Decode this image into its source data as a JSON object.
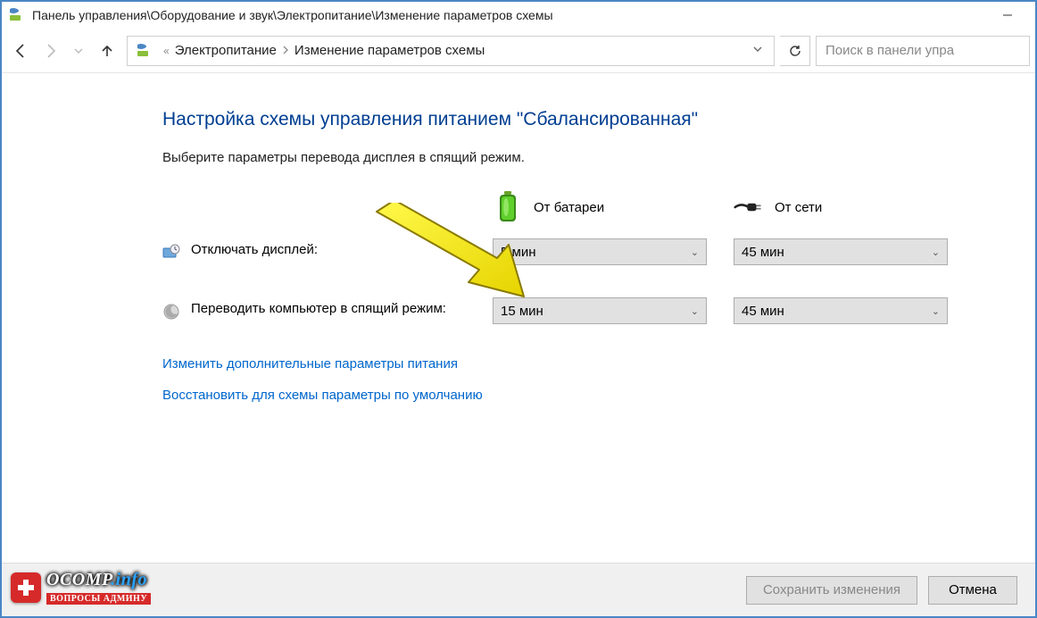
{
  "titlebar": {
    "path": "Панель управления\\Оборудование и звук\\Электропитание\\Изменение параметров схемы"
  },
  "address": {
    "seg1": "Электропитание",
    "seg2": "Изменение параметров схемы"
  },
  "search": {
    "placeholder": "Поиск в панели упра"
  },
  "page": {
    "heading": "Настройка схемы управления питанием \"Сбалансированная\"",
    "subtext": "Выберите параметры перевода дисплея в спящий режим."
  },
  "columns": {
    "battery": "От батареи",
    "plugged": "От сети"
  },
  "rows": {
    "display_off": {
      "label": "Отключать дисплей:",
      "battery": "5 мин",
      "plugged": "45 мин"
    },
    "sleep": {
      "label": "Переводить компьютер в спящий режим:",
      "battery": "15 мин",
      "plugged": "45 мин"
    }
  },
  "links": {
    "advanced": "Изменить дополнительные параметры питания",
    "restore": "Восстановить для схемы параметры по умолчанию"
  },
  "footer": {
    "save": "Сохранить изменения",
    "cancel": "Отмена"
  },
  "watermark": {
    "site": "OCOMP",
    "domain": ".info",
    "tagline": "ВОПРОСЫ АДМИНУ"
  }
}
